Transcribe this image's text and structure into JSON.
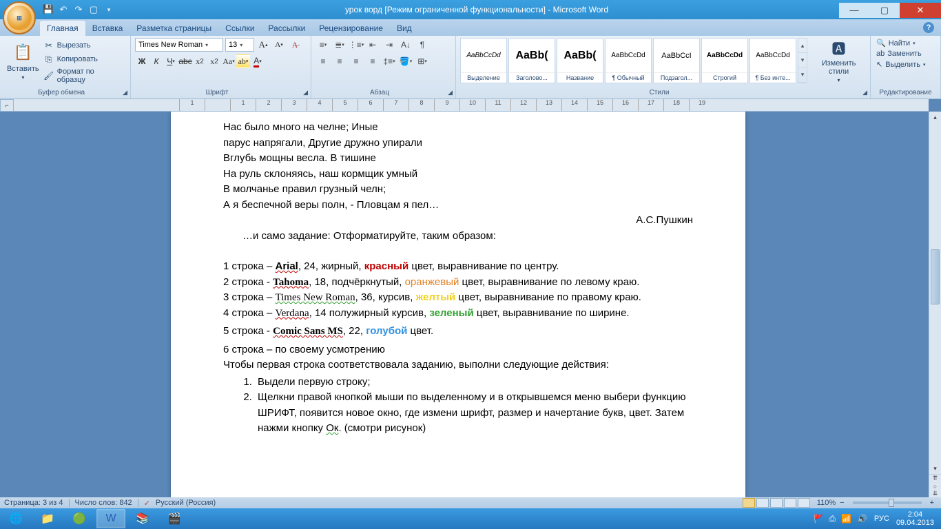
{
  "window": {
    "title": "урок ворд [Режим ограниченной функциональности] - Microsoft Word"
  },
  "tabs": {
    "home": "Главная",
    "insert": "Вставка",
    "layout": "Разметка страницы",
    "references": "Ссылки",
    "mailings": "Рассылки",
    "review": "Рецензирование",
    "view": "Вид"
  },
  "ribbon": {
    "paste": "Вставить",
    "cut": "Вырезать",
    "copy": "Копировать",
    "format_painter": "Формат по образцу",
    "clipboard_group": "Буфер обмена",
    "font_name": "Times New Roman",
    "font_size": "13",
    "font_group": "Шрифт",
    "paragraph_group": "Абзац",
    "styles_group": "Стили",
    "change_styles": "Изменить стили",
    "editing_group": "Редактирование",
    "find": "Найти",
    "replace": "Заменить",
    "select": "Выделить",
    "styles": [
      {
        "preview": "AaBbCcDd",
        "name": "Выделение",
        "italic": true,
        "size": "10px"
      },
      {
        "preview": "AaBb(",
        "name": "Заголово...",
        "bold": true,
        "size": "16px"
      },
      {
        "preview": "AaBb(",
        "name": "Название",
        "bold": true,
        "size": "16px"
      },
      {
        "preview": "AaBbCcDd",
        "name": "¶ Обычный",
        "size": "10px"
      },
      {
        "preview": "AaBbCcI",
        "name": "Подзагол...",
        "size": "11px"
      },
      {
        "preview": "AaBbCcDd",
        "name": "Строгий",
        "bold": true,
        "size": "10px"
      },
      {
        "preview": "AaBbCcDd",
        "name": "¶ Без инте...",
        "size": "10px"
      }
    ]
  },
  "ruler_marks": [
    "1",
    "",
    "1",
    "2",
    "3",
    "4",
    "5",
    "6",
    "7",
    "8",
    "9",
    "10",
    "11",
    "12",
    "13",
    "14",
    "15",
    "16",
    "17",
    "18",
    "19"
  ],
  "document": {
    "poem": [
      "Нас было много на челне; Иные",
      "парус напрягали, Другие дружно упирали",
      "Вглубь мощны весла. В тишине",
      "На руль склоняясь, наш кормщик умный",
      "В молчанье правил грузный челн;",
      "А я беспечной веры полн,  - Пловцам я пел…"
    ],
    "author": "А.С.Пушкин",
    "task_intro": "…и само задание: Отформатируйте, таким образом:",
    "line1_a": "1 строка – ",
    "line1_font": "Arial",
    "line1_b": ", 24, жирный, ",
    "line1_color": "красный",
    "line1_c": " цвет,  выравнивание по центру.",
    "line2_a": "2 строка - ",
    "line2_font": "Tahoma",
    "line2_b": ", 18, подчёркнутый, ",
    "line2_color": "оранжевый",
    "line2_c": " цвет, выравнивание по левому краю.",
    "line3_a": "3 строка – ",
    "line3_font": "Times New Roman",
    "line3_b": ", 36, курсив, ",
    "line3_color": "желтый",
    "line3_c": " цвет,  выравнивание по правому краю.",
    "line4_a": "4 строка – ",
    "line4_font": "Verdana",
    "line4_b": ", 14 полужирный курсив, ",
    "line4_color": "зеленый",
    "line4_c": " цвет,  выравнивание по ширине.",
    "line5_a": "5 строка - ",
    "line5_font": "Comic Sans MS",
    "line5_b": ", 22,  ",
    "line5_color": "голубой",
    "line5_c": " цвет.",
    "line6": "6 строка – по своему усмотрению",
    "instr": "Чтобы первая строка соответствовала заданию, выполни следующие действия:",
    "step1": "Выдели первую строку;",
    "step2": "Щелкни правой кнопкой мыши по выделенному и в открывшемся меню выбери функцию ШРИФТ, появится новое окно, где измени шрифт, размер и начертание букв, цвет. Затем нажми кнопку ",
    "step2_ok": "Ок",
    "step2_tail": ". (смотри рисунок)"
  },
  "status": {
    "page": "Страница: 3 из 4",
    "words": "Число слов: 842",
    "language": "Русский (Россия)",
    "zoom": "110%"
  },
  "tray": {
    "lang": "РУС",
    "time": "2:04",
    "date": "09.04.2013"
  }
}
